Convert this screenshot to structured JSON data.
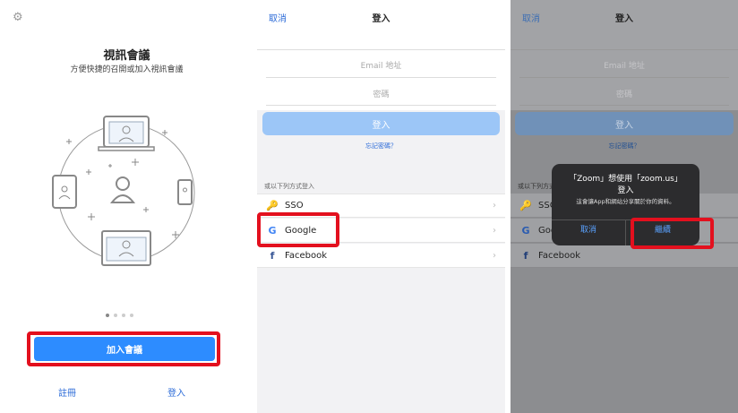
{
  "panel1": {
    "title": "視訊會議",
    "subtitle": "方便快捷的召開或加入視訊會議",
    "join_button": "加入會議",
    "register_link": "註冊",
    "login_link": "登入"
  },
  "panel2": {
    "cancel": "取消",
    "title": "登入",
    "email_placeholder": "Email 地址",
    "password_placeholder": "密碼",
    "login_button": "登入",
    "forgot_password": "忘記密碼？",
    "or_login_with": "或以下列方式登入",
    "options": [
      {
        "label": "SSO",
        "icon": "key-icon"
      },
      {
        "label": "Google",
        "icon": "google-icon"
      },
      {
        "label": "Facebook",
        "icon": "facebook-icon"
      }
    ]
  },
  "panel3": {
    "cancel": "取消",
    "title": "登入",
    "email_placeholder": "Email 地址",
    "password_placeholder": "密碼",
    "login_button": "登入",
    "forgot_password": "忘記密碼？",
    "or_login_with": "或以下列方式",
    "sso_label": "SSO",
    "google_label": "Goo",
    "facebook_label": "Facebook",
    "dialog_line1": "「Zoom」想使用「zoom.us」",
    "dialog_line2": "登入",
    "dialog_message": "這會讓App和網站分享關於你的資料。",
    "dialog_cancel": "取消",
    "dialog_continue": "繼續"
  },
  "colors": {
    "accent": "#2d8cff",
    "link": "#2d6cd8",
    "highlight": "#e3101e"
  }
}
